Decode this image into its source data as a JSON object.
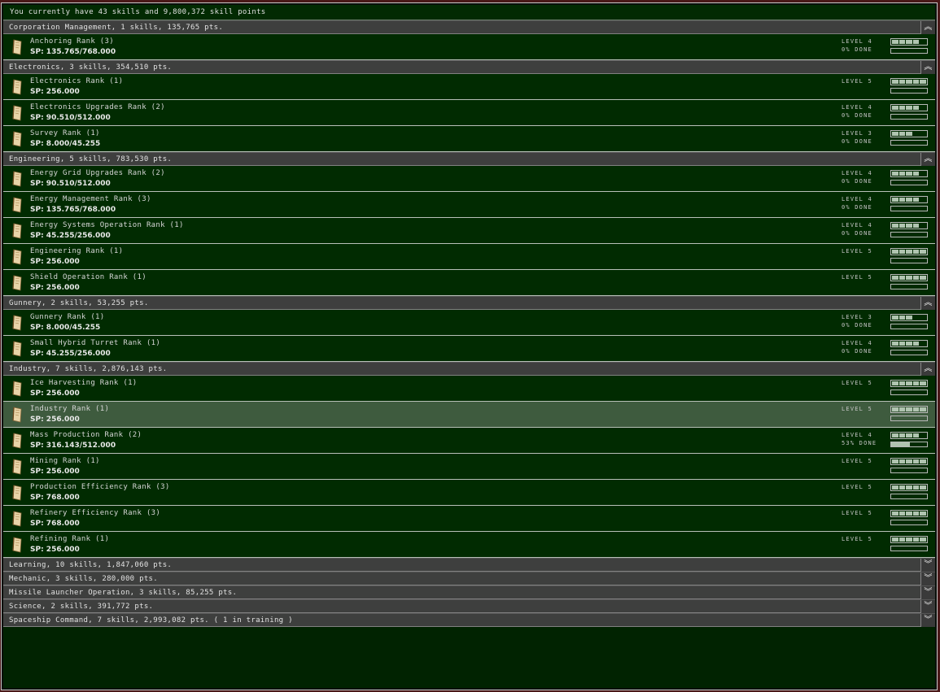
{
  "summary": "You currently have 43 skills and 9,800,372 skill points",
  "groups": [
    {
      "label": "Corporation Management, 1 skills, 135,765 pts.",
      "expanded": true,
      "skills": [
        {
          "name": "Anchoring Rank (3)",
          "sp": "SP: 135.765/768.000",
          "level_text": "LEVEL 4",
          "level": 4,
          "done_text": "0% DONE",
          "progress": 0
        }
      ]
    },
    {
      "label": "Electronics, 3 skills, 354,510 pts.",
      "expanded": true,
      "skills": [
        {
          "name": "Electronics Rank (1)",
          "sp": "SP: 256.000",
          "level_text": "LEVEL 5",
          "level": 5,
          "done_text": "",
          "progress": 0
        },
        {
          "name": "Electronics Upgrades Rank (2)",
          "sp": "SP: 90.510/512.000",
          "level_text": "LEVEL 4",
          "level": 4,
          "done_text": "0% DONE",
          "progress": 0
        },
        {
          "name": "Survey Rank (1)",
          "sp": "SP: 8.000/45.255",
          "level_text": "LEVEL 3",
          "level": 3,
          "done_text": "0% DONE",
          "progress": 0
        }
      ]
    },
    {
      "label": "Engineering, 5 skills, 783,530 pts.",
      "expanded": true,
      "skills": [
        {
          "name": "Energy Grid Upgrades Rank (2)",
          "sp": "SP: 90.510/512.000",
          "level_text": "LEVEL 4",
          "level": 4,
          "done_text": "0% DONE",
          "progress": 0
        },
        {
          "name": "Energy Management Rank (3)",
          "sp": "SP: 135.765/768.000",
          "level_text": "LEVEL 4",
          "level": 4,
          "done_text": "0% DONE",
          "progress": 0
        },
        {
          "name": "Energy Systems Operation Rank (1)",
          "sp": "SP: 45.255/256.000",
          "level_text": "LEVEL 4",
          "level": 4,
          "done_text": "0% DONE",
          "progress": 0
        },
        {
          "name": "Engineering Rank (1)",
          "sp": "SP: 256.000",
          "level_text": "LEVEL 5",
          "level": 5,
          "done_text": "",
          "progress": 0
        },
        {
          "name": "Shield Operation Rank (1)",
          "sp": "SP: 256.000",
          "level_text": "LEVEL 5",
          "level": 5,
          "done_text": "",
          "progress": 0
        }
      ]
    },
    {
      "label": "Gunnery, 2 skills, 53,255 pts.",
      "expanded": true,
      "skills": [
        {
          "name": "Gunnery Rank (1)",
          "sp": "SP: 8.000/45.255",
          "level_text": "LEVEL 3",
          "level": 3,
          "done_text": "0% DONE",
          "progress": 0
        },
        {
          "name": "Small Hybrid Turret Rank (1)",
          "sp": "SP: 45.255/256.000",
          "level_text": "LEVEL 4",
          "level": 4,
          "done_text": "0% DONE",
          "progress": 0
        }
      ]
    },
    {
      "label": "Industry, 7 skills, 2,876,143 pts.",
      "expanded": true,
      "skills": [
        {
          "name": "Ice Harvesting Rank (1)",
          "sp": "SP: 256.000",
          "level_text": "LEVEL 5",
          "level": 5,
          "done_text": "",
          "progress": 0
        },
        {
          "name": "Industry Rank (1)",
          "sp": "SP: 256.000",
          "level_text": "LEVEL 5",
          "level": 5,
          "done_text": "",
          "progress": 0,
          "selected": true
        },
        {
          "name": "Mass Production Rank (2)",
          "sp": "SP: 316.143/512.000",
          "level_text": "LEVEL 4",
          "level": 4,
          "done_text": "53% DONE",
          "progress": 0.53
        },
        {
          "name": "Mining Rank (1)",
          "sp": "SP: 256.000",
          "level_text": "LEVEL 5",
          "level": 5,
          "done_text": "",
          "progress": 0
        },
        {
          "name": "Production Efficiency Rank (3)",
          "sp": "SP: 768.000",
          "level_text": "LEVEL 5",
          "level": 5,
          "done_text": "",
          "progress": 0
        },
        {
          "name": "Refinery Efficiency Rank (3)",
          "sp": "SP: 768.000",
          "level_text": "LEVEL 5",
          "level": 5,
          "done_text": "",
          "progress": 0
        },
        {
          "name": "Refining Rank (1)",
          "sp": "SP: 256.000",
          "level_text": "LEVEL 5",
          "level": 5,
          "done_text": "",
          "progress": 0
        }
      ]
    },
    {
      "label": "Learning, 10 skills, 1,847,060 pts.",
      "expanded": false,
      "skills": []
    },
    {
      "label": "Mechanic, 3 skills, 280,000 pts.",
      "expanded": false,
      "skills": []
    },
    {
      "label": "Missile Launcher Operation, 3 skills, 85,255 pts.",
      "expanded": false,
      "skills": []
    },
    {
      "label": "Science, 2 skills, 391,772 pts.",
      "expanded": false,
      "skills": []
    },
    {
      "label": "Spaceship Command, 7 skills, 2,993,082 pts. ( 1 in training )",
      "expanded": false,
      "skills": []
    }
  ],
  "icons": {
    "expanded": "collapse-chevrons-up-icon",
    "collapsed": "expand-chevrons-down-icon",
    "skill": "skillbook-icon"
  },
  "glyphs": {
    "expanded": "︽",
    "collapsed": "︾"
  }
}
